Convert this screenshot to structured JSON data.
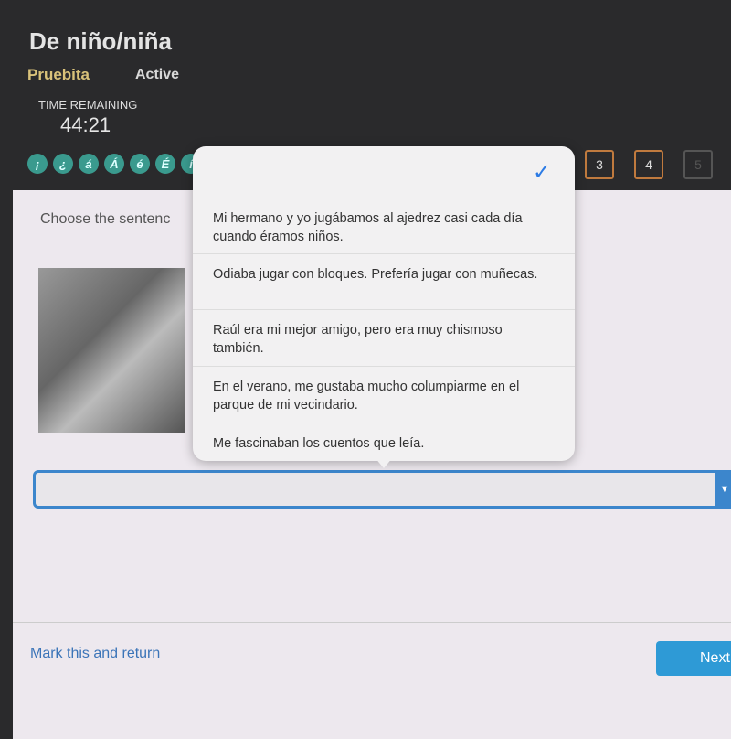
{
  "header": {
    "title": "De niño/niña",
    "course": "Pruebita",
    "status": "Active",
    "time_label": "TIME REMAINING",
    "time": "44:21"
  },
  "accents": [
    "¡",
    "¿",
    "á",
    "Á",
    "é",
    "É",
    "í"
  ],
  "questions": [
    {
      "n": "3",
      "enabled": true
    },
    {
      "n": "4",
      "enabled": true
    },
    {
      "n": "5",
      "enabled": false
    }
  ],
  "prompt": "Choose the sentenc",
  "dropdown": {
    "selected": "",
    "options": [
      "Mi hermano y yo jugábamos al ajedrez casi cada día cuando éramos niños.",
      "Odiaba jugar con bloques. Prefería jugar con muñecas.",
      "Raúl era mi mejor amigo, pero era muy chismoso también.",
      "En el verano, me gustaba mucho columpiarme en el parque de mi vecindario.",
      "Me fascinaban los cuentos que leía."
    ]
  },
  "footer": {
    "mark": "Mark this and return",
    "next": "Next"
  },
  "colors": {
    "accent": "#3c86cc",
    "course": "#d9c27a",
    "qborder": "#c07a3e"
  }
}
